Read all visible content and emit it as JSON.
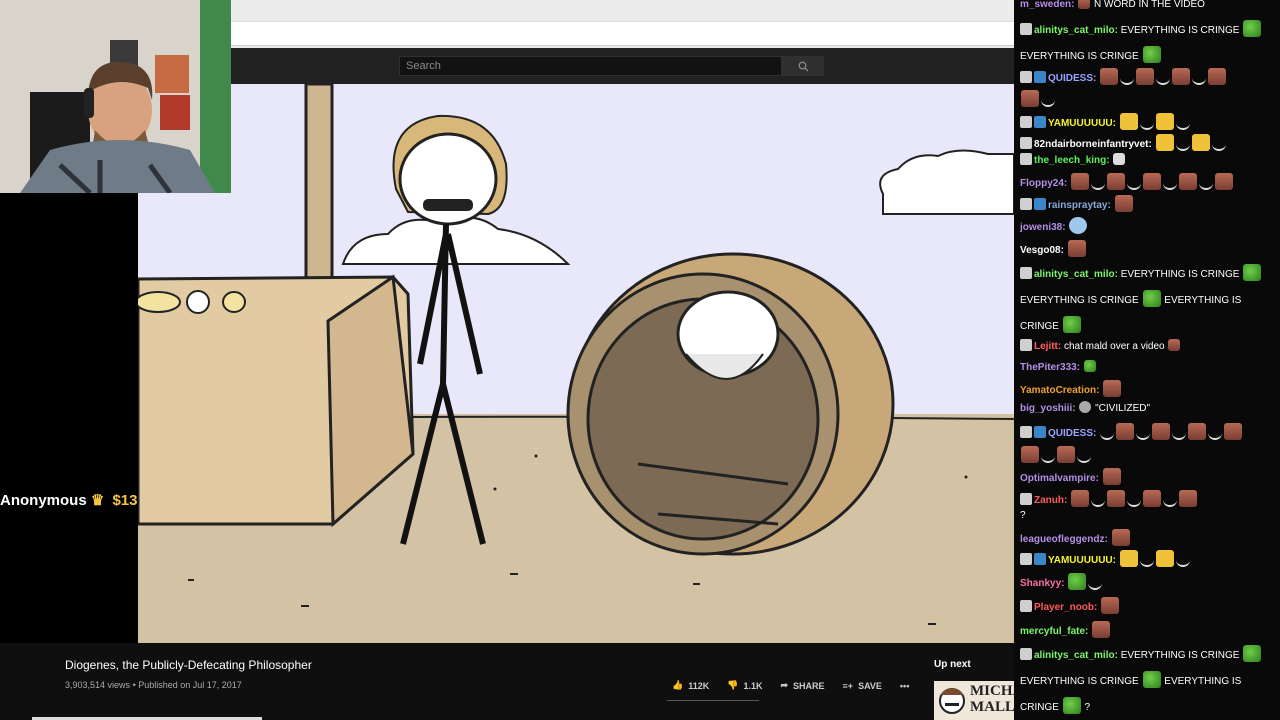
{
  "youtube": {
    "search_placeholder": "Search",
    "video_title": "Diogenes, the Publicly-Defecating Philosopher",
    "views": "3,903,514 views",
    "published": "• Published on Jul 17, 2017",
    "likes": "112K",
    "dislikes": "1.1K",
    "share_label": "SHARE",
    "save_label": "SAVE",
    "more_label": "•••",
    "up_next_label": "Up next",
    "up_next_thumb_text": "MICHAEL MALL"
  },
  "donation": {
    "name": "Anonymous",
    "amount": "$13"
  },
  "chat": {
    "messages": [
      {
        "user": "m_sweden:",
        "user_color": "#b58ee8",
        "text": "N WORD IN THE VIDEO"
      },
      {
        "user": "alinitys_cat_milo:",
        "user_color": "#7cf56a",
        "text": "EVERYTHING IS CRINGE"
      },
      {
        "user": "",
        "user_color": "#ffffff",
        "text": "EVERYTHING IS CRINGE"
      },
      {
        "user": "QUIDESS:",
        "user_color": "#9aa4ff",
        "text": ""
      },
      {
        "user": "YAMUUUUUU:",
        "user_color": "#f5f530",
        "text": ""
      },
      {
        "user": "82ndairborneinfantryvet:",
        "user_color": "#ffffff",
        "text": ""
      },
      {
        "user": "the_leech_king:",
        "user_color": "#5af05a",
        "text": ""
      },
      {
        "user": "Floppy24:",
        "user_color": "#b58ee8",
        "text": ""
      },
      {
        "user": "rainspraytay:",
        "user_color": "#8aa8d8",
        "text": ""
      },
      {
        "user": "joweni38:",
        "user_color": "#b58ee8",
        "text": ""
      },
      {
        "user": "Vesgo08:",
        "user_color": "#ffffff",
        "text": ""
      },
      {
        "user": "alinitys_cat_milo:",
        "user_color": "#7cf56a",
        "text": "EVERYTHING IS CRINGE"
      },
      {
        "user": "",
        "user_color": "#ffffff",
        "text": "EVERYTHING IS CRINGE"
      },
      {
        "user": "",
        "user_color": "#ffffff",
        "text": "EVERYTHING IS"
      },
      {
        "user": "",
        "user_color": "#ffffff",
        "text": "CRINGE"
      },
      {
        "user": "Lejitt:",
        "user_color": "#ff6060",
        "text": "chat mald over a video"
      },
      {
        "user": "ThePiter333:",
        "user_color": "#b58ee8",
        "text": ""
      },
      {
        "user": "YamatoCreation:",
        "user_color": "#f0a030",
        "text": ""
      },
      {
        "user": "big_yoshiii:",
        "user_color": "#b58ee8",
        "text": "\"CIVILIZED\""
      },
      {
        "user": "QUIDESS:",
        "user_color": "#9aa4ff",
        "text": ""
      },
      {
        "user": "Optimalvampire:",
        "user_color": "#b58ee8",
        "text": ""
      },
      {
        "user": "Zanuh:",
        "user_color": "#ff5a5a",
        "text": ""
      },
      {
        "user": "",
        "user_color": "#ffffff",
        "text": "?"
      },
      {
        "user": "leagueofleggendz:",
        "user_color": "#b58ee8",
        "text": ""
      },
      {
        "user": "YAMUUUUUU:",
        "user_color": "#f5f530",
        "text": ""
      },
      {
        "user": "Shankyy:",
        "user_color": "#ff6fa8",
        "text": ""
      },
      {
        "user": "Player_noob:",
        "user_color": "#ff5a5a",
        "text": ""
      },
      {
        "user": "mercyful_fate:",
        "user_color": "#7cf56a",
        "text": ""
      },
      {
        "user": "alinitys_cat_milo:",
        "user_color": "#7cf56a",
        "text": "EVERYTHING IS CRINGE"
      },
      {
        "user": "",
        "user_color": "#ffffff",
        "text": "EVERYTHING IS CRINGE"
      },
      {
        "user": "",
        "user_color": "#ffffff",
        "text": "EVERYTHING IS"
      },
      {
        "user": "",
        "user_color": "#ffffff",
        "text": "CRINGE"
      },
      {
        "user": "",
        "user_color": "#ffffff",
        "text": "?"
      }
    ]
  }
}
